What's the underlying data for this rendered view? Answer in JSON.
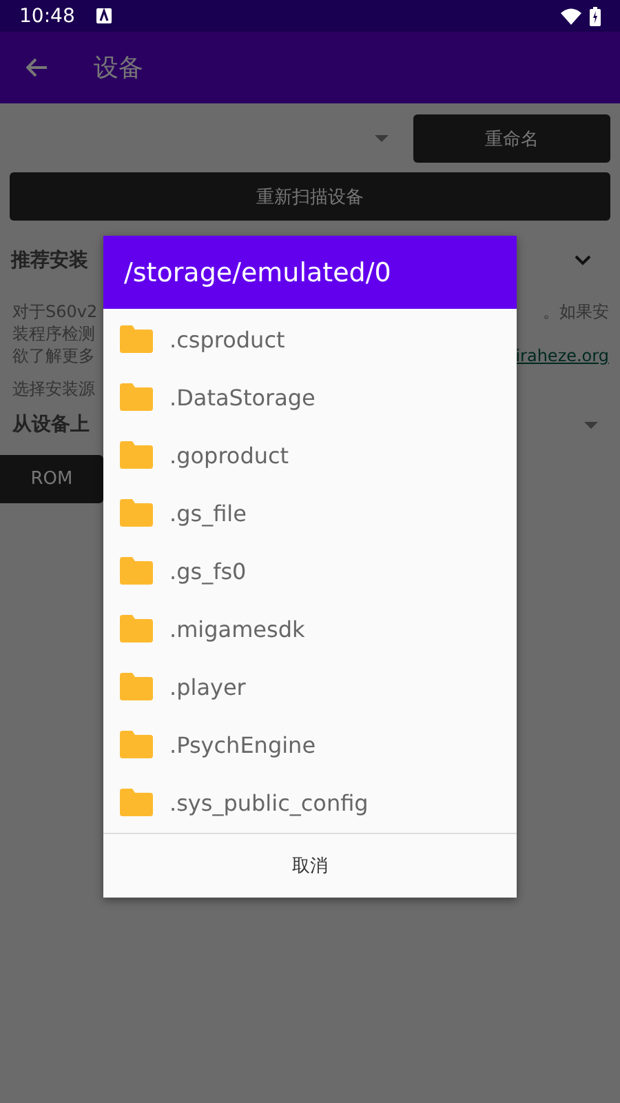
{
  "status_bar": {
    "time": "10:48"
  },
  "app_bar": {
    "title": "设备"
  },
  "device_row": {
    "rename_button": "重命名"
  },
  "rescan_button": "重新扫描设备",
  "section": {
    "title": "推荐安装",
    "expanded": true
  },
  "description": {
    "lines": [
      {
        "left": "对于S60v2",
        "right": "。如果安"
      },
      {
        "left": "装程序检测"
      },
      {
        "left": "欲了解更多",
        "right": "iraheze.org",
        "link": true
      }
    ]
  },
  "source_label": "选择安装源",
  "source_dropdown": {
    "value": "从设备上"
  },
  "rom_button": "ROM",
  "dialog": {
    "title": "/storage/emulated/0",
    "folders": [
      ".csproduct",
      ".DataStorage",
      ".goproduct",
      ".gs_file",
      ".gs_fs0",
      ".migamesdk",
      ".player",
      ".PsychEngine",
      ".sys_public_config"
    ],
    "cancel": "取消"
  }
}
